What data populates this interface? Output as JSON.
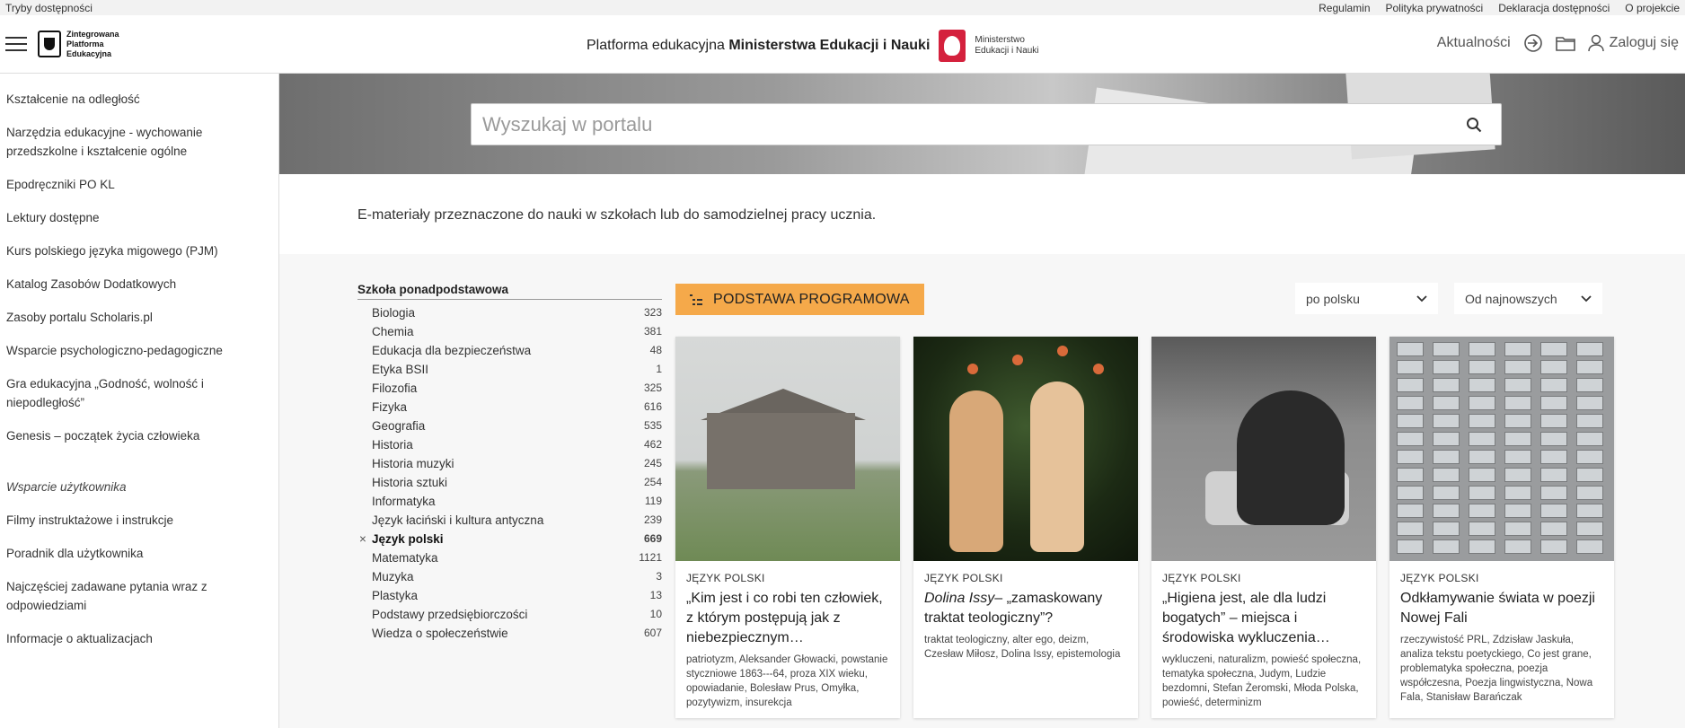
{
  "topbar": {
    "accessibility": "Tryby dostępności",
    "links": [
      "Regulamin",
      "Polityka prywatności",
      "Deklaracja dostępności",
      "O projekcie"
    ]
  },
  "header": {
    "logo_lines": [
      "Zintegrowana",
      "Platforma",
      "Edukacyjna"
    ],
    "title_prefix": "Platforma edukacyjna",
    "title_bold": "Ministerstwa Edukacji i Nauki",
    "ministry_lines": [
      "Ministerstwo",
      "Edukacji i Nauki"
    ],
    "news": "Aktualności",
    "login": "Zaloguj się"
  },
  "sidebar": {
    "items": [
      "Kształcenie na odległość",
      "Narzędzia edukacyjne - wychowanie przedszkolne i kształcenie ogólne",
      "Epodręczniki PO KL",
      "Lektury dostępne",
      "Kurs polskiego języka migowego (PJM)",
      "Katalog Zasobów Dodatkowych",
      "Zasoby portalu Scholaris.pl",
      "Wsparcie psychologiczno-pedagogiczne",
      "Gra edukacyjna „Godność, wolność i niepodległość”",
      "Genesis – początek życia człowieka"
    ],
    "section": "Wsparcie użytkownika",
    "support_items": [
      "Filmy instruktażowe i instrukcje",
      "Poradnik dla użytkownika",
      "Najczęściej zadawane pytania wraz z odpowiedziami",
      "Informacje o aktualizacjach"
    ]
  },
  "search": {
    "placeholder": "Wyszukaj w portalu"
  },
  "intro": "E-materiały przeznaczone do nauki w szkołach lub do samodzielnej pracy ucznia.",
  "filters": {
    "heading": "Szkoła ponadpodstawowa",
    "rows": [
      {
        "label": "Biologia",
        "count": "323",
        "active": false
      },
      {
        "label": "Chemia",
        "count": "381",
        "active": false
      },
      {
        "label": "Edukacja dla bezpieczeństwa",
        "count": "48",
        "active": false
      },
      {
        "label": "Etyka BSII",
        "count": "1",
        "active": false
      },
      {
        "label": "Filozofia",
        "count": "325",
        "active": false
      },
      {
        "label": "Fizyka",
        "count": "616",
        "active": false
      },
      {
        "label": "Geografia",
        "count": "535",
        "active": false
      },
      {
        "label": "Historia",
        "count": "462",
        "active": false
      },
      {
        "label": "Historia muzyki",
        "count": "245",
        "active": false
      },
      {
        "label": "Historia sztuki",
        "count": "254",
        "active": false
      },
      {
        "label": "Informatyka",
        "count": "119",
        "active": false
      },
      {
        "label": "Język łaciński i kultura antyczna",
        "count": "239",
        "active": false
      },
      {
        "label": "Język polski",
        "count": "669",
        "active": true
      },
      {
        "label": "Matematyka",
        "count": "1121",
        "active": false
      },
      {
        "label": "Muzyka",
        "count": "3",
        "active": false
      },
      {
        "label": "Plastyka",
        "count": "13",
        "active": false
      },
      {
        "label": "Podstawy przedsiębiorczości",
        "count": "10",
        "active": false
      },
      {
        "label": "Wiedza o społeczeństwie",
        "count": "607",
        "active": false
      }
    ]
  },
  "toolbar": {
    "core_curriculum": "PODSTAWA PROGRAMOWA",
    "language": "po polsku",
    "sort": "Od najnowszych"
  },
  "cards": [
    {
      "category": "JĘZYK POLSKI",
      "title": "„Kim jest i co robi ten człowiek, z którym postępują jak z niebezpiecznym…",
      "title_italic": "",
      "tags": "patriotyzm, Aleksander Głowacki, powstanie styczniowe 1863--‑64, proza XIX wieku, opowiadanie, Bolesław Prus, Omyłka, pozytywizm, insurekcja"
    },
    {
      "category": "JĘZYK POLSKI",
      "title_italic": "Dolina Issy",
      "title": "– „zamaskowany traktat teologiczny”?",
      "tags": "traktat teologiczny, alter ego, deizm, Czesław Miłosz, Dolina Issy, epistemologia"
    },
    {
      "category": "JĘZYK POLSKI",
      "title": "„Higiena jest, ale dla ludzi bogatych” – miejsca i środowiska wykluczenia…",
      "title_italic": "",
      "tags": "wykluczeni, naturalizm, powieść społeczna, tematyka społeczna, Judym, Ludzie bezdomni, Stefan Żeromski, Młoda Polska, powieść, determinizm"
    },
    {
      "category": "JĘZYK POLSKI",
      "title": "Odkłamywanie świata w poezji Nowej Fali",
      "title_italic": "",
      "tags": "rzeczywistość PRL, Zdzisław Jaskuła, analiza tekstu poetyckiego, Co jest grane, problematyka społeczna, poezja współczesna, Poezja lingwistyczna, Nowa Fala, Stanisław Barańczak"
    }
  ]
}
